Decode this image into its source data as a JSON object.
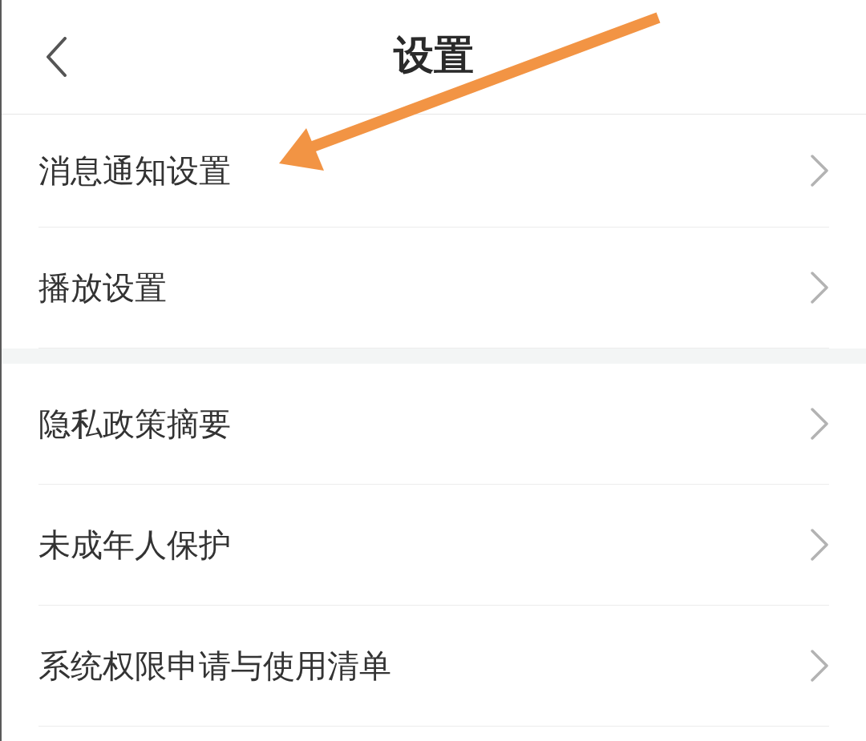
{
  "header": {
    "title": "设置"
  },
  "sections": [
    {
      "items": [
        {
          "label": "消息通知设置"
        },
        {
          "label": "播放设置"
        }
      ]
    },
    {
      "items": [
        {
          "label": "隐私政策摘要"
        },
        {
          "label": "未成年人保护"
        },
        {
          "label": "系统权限申请与使用清单"
        }
      ]
    }
  ]
}
